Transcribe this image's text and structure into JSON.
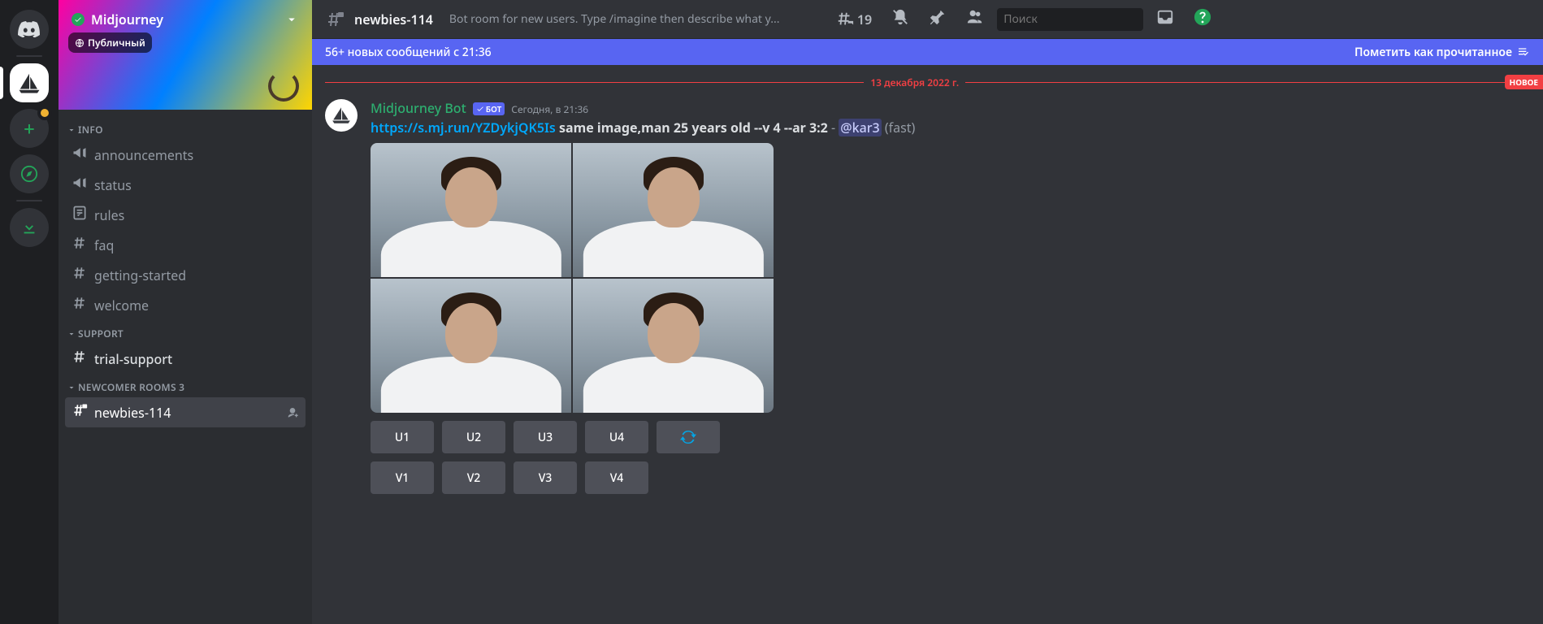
{
  "server": {
    "name": "Midjourney",
    "publicBadge": "Публичный"
  },
  "categories": [
    {
      "name": "INFO",
      "channels": [
        {
          "label": "announcements",
          "icon": "megaphone"
        },
        {
          "label": "status",
          "icon": "megaphone"
        },
        {
          "label": "rules",
          "icon": "rules"
        },
        {
          "label": "faq",
          "icon": "hash"
        },
        {
          "label": "getting-started",
          "icon": "hash"
        },
        {
          "label": "welcome",
          "icon": "hash"
        }
      ]
    },
    {
      "name": "SUPPORT",
      "channels": [
        {
          "label": "trial-support",
          "icon": "hash",
          "bright": true
        }
      ]
    },
    {
      "name": "NEWCOMER ROOMS 3",
      "channels": [
        {
          "label": "newbies-114",
          "icon": "hash-lock",
          "active": true
        }
      ]
    }
  ],
  "topbar": {
    "channel": "newbies-114",
    "description": "Bot room for new users. Type /imagine then describe what y...",
    "threadsCount": "19",
    "searchPlaceholder": "Поиск"
  },
  "newMsg": {
    "text": "56+ новых сообщений с 21:36",
    "mark": "Пометить как прочитанное"
  },
  "divider": {
    "date": "13 декабря 2022 г.",
    "new": "НОВОЕ"
  },
  "message": {
    "author": "Midjourney Bot",
    "botTag": "БОТ",
    "timestamp": "Сегодня, в 21:36",
    "link": "https://s.mj.run/YZDykjQK5Is",
    "promptBold": "same image,man 25 years old --v 4 --ar 3:2",
    "dash": " - ",
    "mention": "@kar3",
    "mode": " (fast)"
  },
  "buttons": {
    "u": [
      "U1",
      "U2",
      "U3",
      "U4"
    ],
    "v": [
      "V1",
      "V2",
      "V3",
      "V4"
    ]
  }
}
